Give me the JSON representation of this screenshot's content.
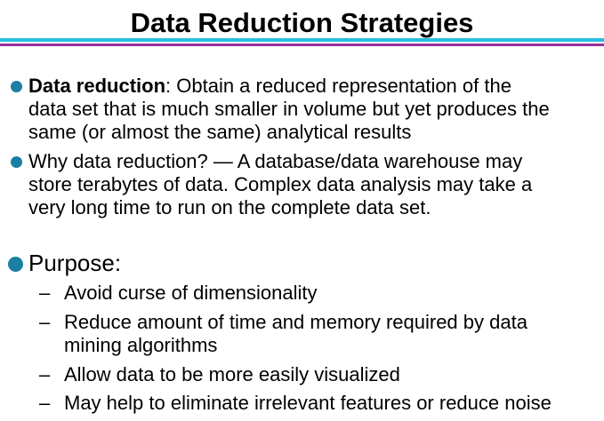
{
  "slide": {
    "title": "Data Reduction Strategies",
    "colors": {
      "rule_top": "#27bde0",
      "rule_bottom": "#9b2f9b",
      "bullet": "#1a7fa2"
    },
    "bullets": [
      {
        "icon": "bullet-dot-icon",
        "bold": "Data reduction",
        "lines": [
          ": Obtain a reduced representation of the",
          "data set that is much smaller in volume but yet produces the",
          "same (or almost the same) analytical results"
        ]
      },
      {
        "icon": "bullet-dot-icon",
        "lines": [
          "Why data reduction? — A database/data warehouse may",
          "store terabytes of data.  Complex data analysis may take a",
          "very long time to run on the complete data set."
        ]
      }
    ],
    "purpose": {
      "icon": "bullet-dot-icon",
      "label": "Purpose:",
      "dash": "–",
      "items": [
        {
          "lines": [
            "Avoid curse of dimensionality"
          ]
        },
        {
          "lines": [
            "Reduce amount of time and memory required by data",
            "mining algorithms"
          ]
        },
        {
          "lines": [
            "Allow data to be more easily visualized"
          ]
        },
        {
          "lines": [
            "May help to eliminate irrelevant features or reduce noise"
          ]
        }
      ]
    }
  }
}
